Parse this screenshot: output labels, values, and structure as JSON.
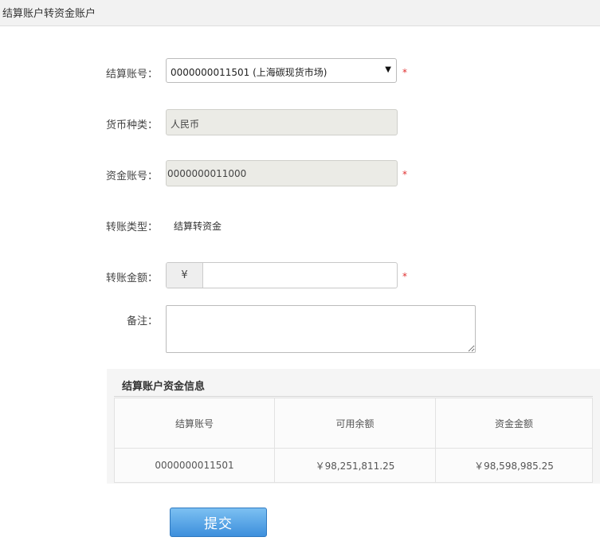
{
  "header": {
    "title": "结算账户转资金账户"
  },
  "form": {
    "settle_account": {
      "label": "结算账号：",
      "value": "0000000011501 (上海碳现货市场)",
      "required_mark": "*"
    },
    "currency": {
      "label": "货币种类：",
      "value": "人民币"
    },
    "fund_account": {
      "label": "资金账号：",
      "value": "0000000011000",
      "required_mark": "*"
    },
    "transfer_type": {
      "label": "转账类型：",
      "value": "结算转资金"
    },
    "amount": {
      "label": "转账金额：",
      "prefix": "¥",
      "value": "",
      "required_mark": "*"
    },
    "remark": {
      "label": "备注：",
      "value": ""
    }
  },
  "info": {
    "title": "结算账户资金信息",
    "columns": [
      "结算账号",
      "可用余额",
      "资金金额"
    ],
    "rows": [
      [
        "0000000011501",
        "￥98,251,811.25",
        "￥98,598,985.25"
      ]
    ]
  },
  "submit_label": "提交"
}
